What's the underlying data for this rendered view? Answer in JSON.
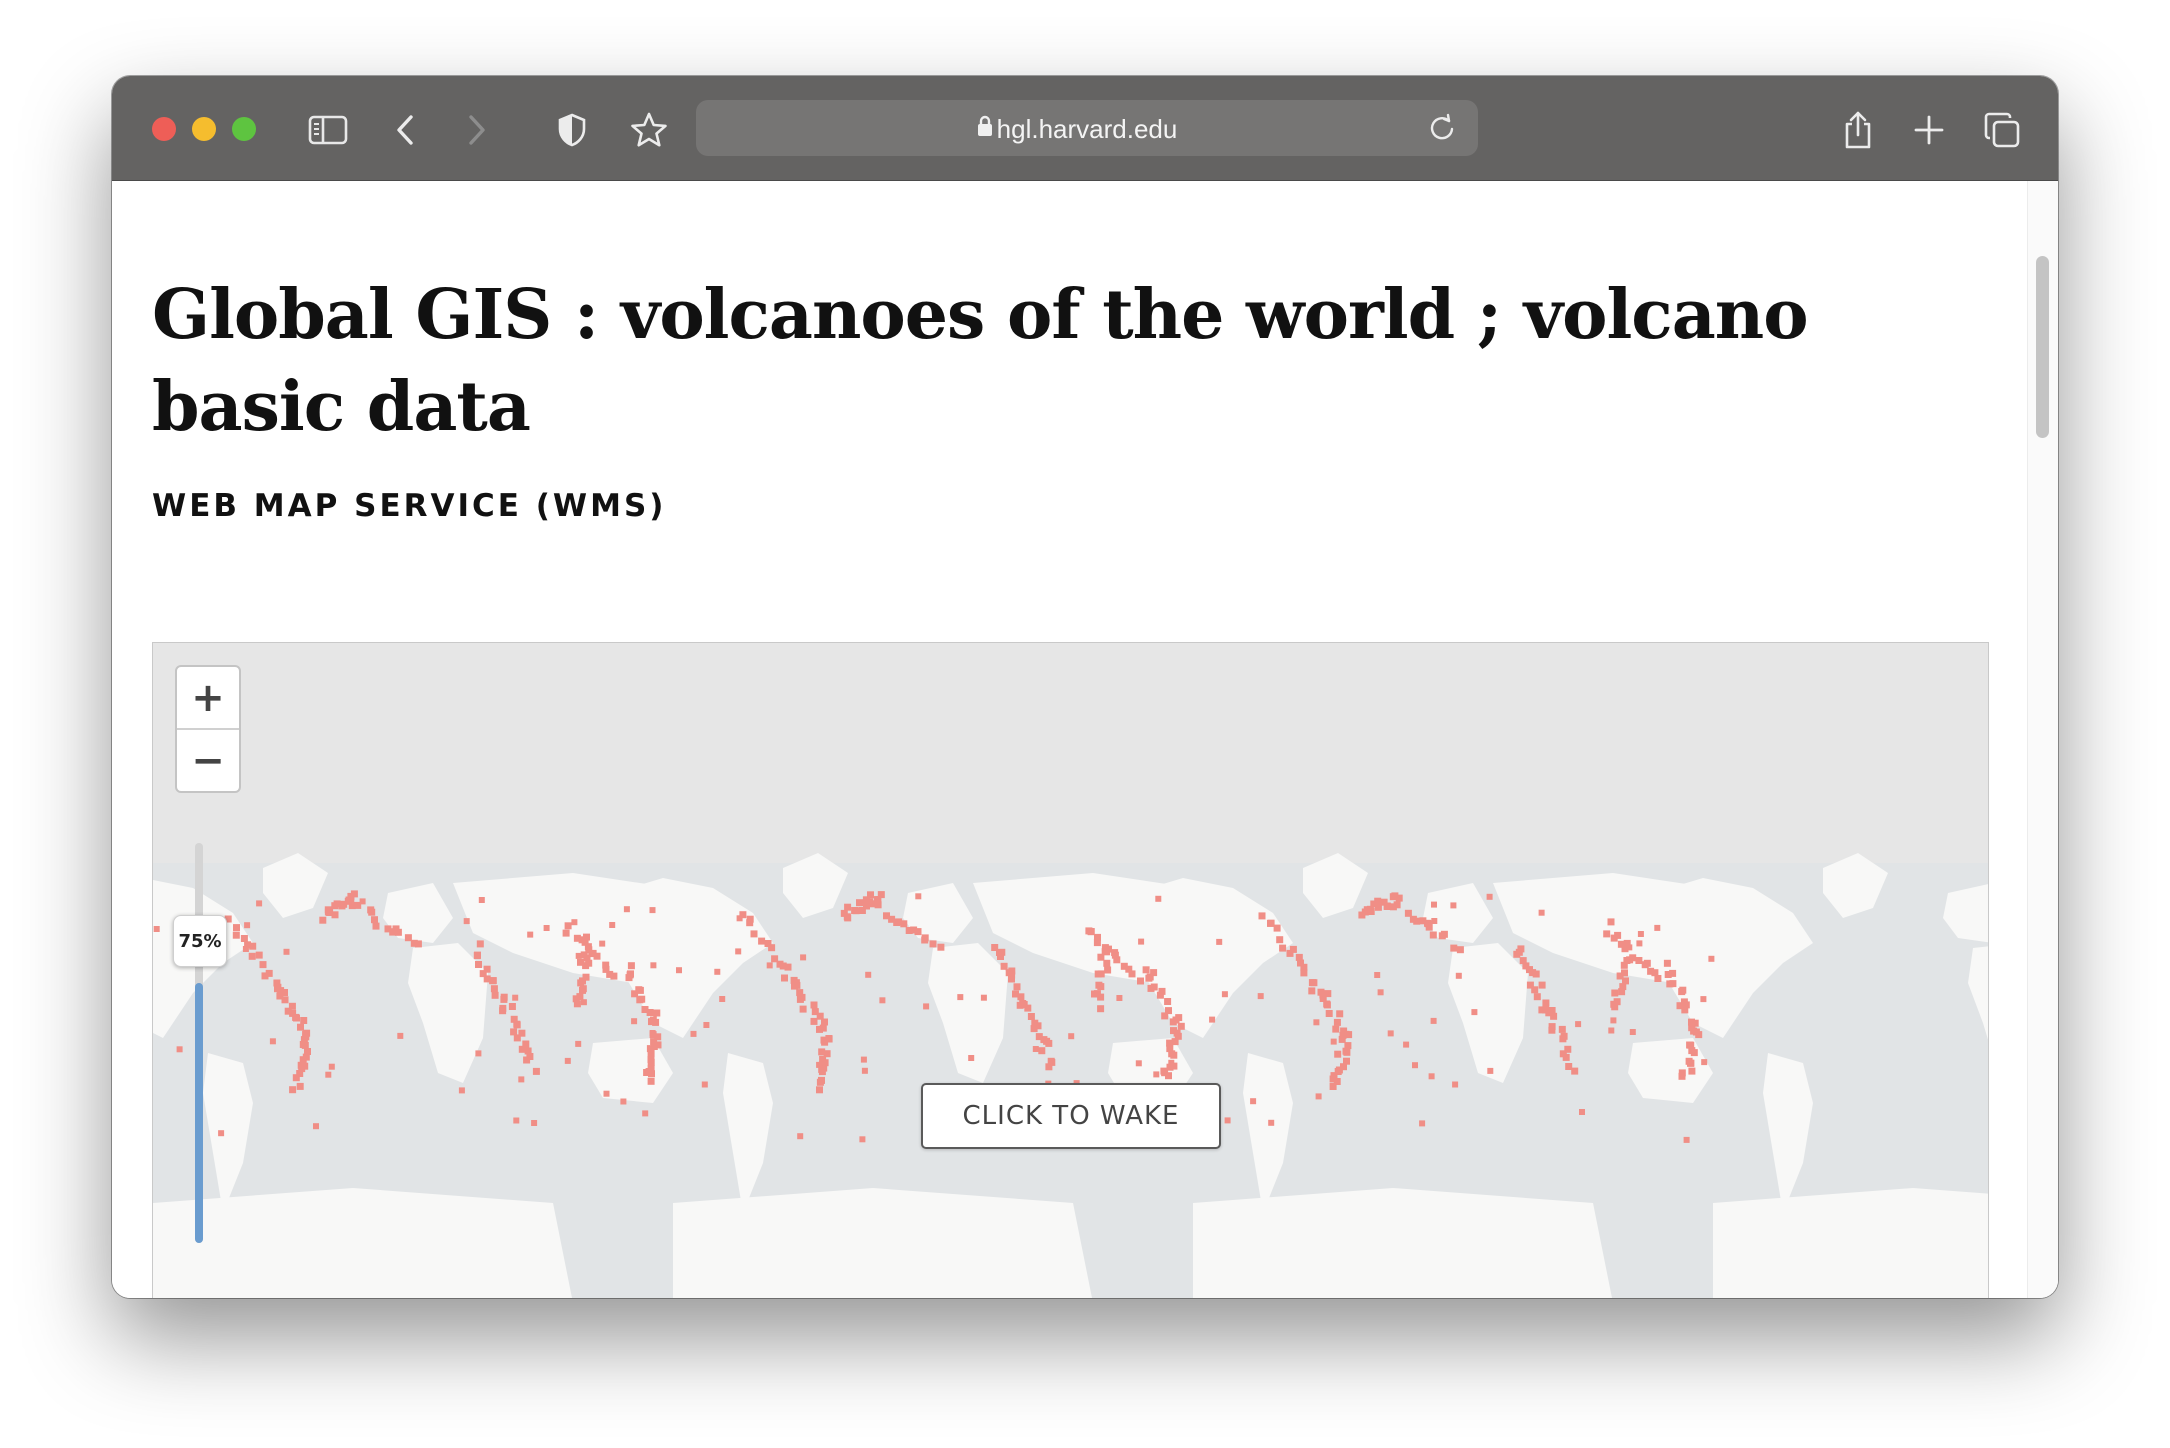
{
  "browser": {
    "url": "hgl.harvard.edu",
    "icons": [
      "sidebar-icon",
      "back-chevron-icon",
      "forward-chevron-icon",
      "shield-icon",
      "star-icon",
      "lock-icon",
      "reload-icon",
      "share-icon",
      "plus-icon",
      "tabs-overview-icon"
    ]
  },
  "page": {
    "title": "Global GIS : volcanoes of the world ; volcano basic data",
    "section_label": "WEB MAP SERVICE (WMS)"
  },
  "map": {
    "zoom_in_label": "+",
    "zoom_out_label": "−",
    "opacity_label": "75%",
    "opacity_value": 0.75,
    "wake_button_label": "CLICK TO WAKE",
    "colors": {
      "ocean": "#e3e5e6",
      "land": "#f8f8f7",
      "volcano": "#f08e86",
      "slider": "#6a9ccf"
    }
  }
}
